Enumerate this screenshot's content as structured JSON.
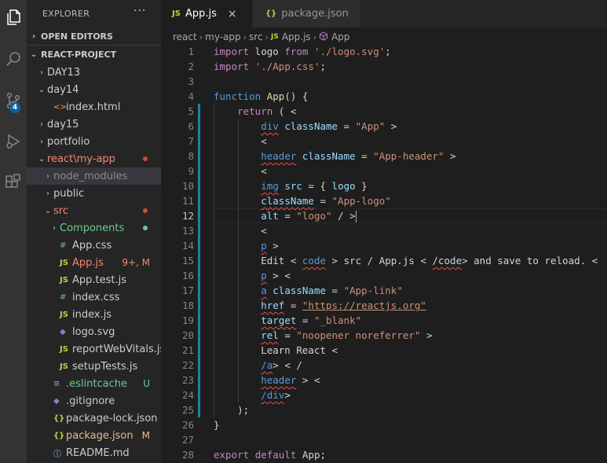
{
  "sidebar": {
    "title": "EXPLORER",
    "more": "···",
    "open_editors": "OPEN EDITORS",
    "project": "REACT-PROJECT",
    "tree": [
      {
        "label": "DAY13",
        "chev": "›",
        "icon": "",
        "deco": "",
        "color": "#cccccc"
      },
      {
        "label": "day14",
        "chev": "⌄",
        "icon": "",
        "deco": "",
        "color": "#cccccc"
      },
      {
        "label": "index.html",
        "chev": "",
        "icon": "<>",
        "deco": "",
        "color": "#cccccc"
      },
      {
        "label": "day15",
        "chev": "›",
        "icon": "",
        "deco": "",
        "color": "#cccccc"
      },
      {
        "label": "portfolio",
        "chev": "›",
        "icon": "",
        "deco": "",
        "color": "#cccccc"
      },
      {
        "label": "react\\my-app",
        "chev": "⌄",
        "icon": "",
        "deco": "",
        "color": "#f48771"
      },
      {
        "label": "node_modules",
        "chev": "›",
        "icon": "",
        "deco": "",
        "color": "#8c8c8c"
      },
      {
        "label": "public",
        "chev": "›",
        "icon": "",
        "deco": "",
        "color": "#cccccc"
      },
      {
        "label": "src",
        "chev": "⌄",
        "icon": "",
        "deco": "",
        "color": "#f48771"
      },
      {
        "label": "Components",
        "chev": "›",
        "icon": "",
        "deco": "",
        "color": "#73c991"
      },
      {
        "label": "App.css",
        "chev": "",
        "icon": "#",
        "deco": "",
        "color": "#cccccc"
      },
      {
        "label": "App.js",
        "chev": "",
        "icon": "JS",
        "deco": "9+, M",
        "color": "#f48771"
      },
      {
        "label": "App.test.js",
        "chev": "",
        "icon": "JS",
        "deco": "",
        "color": "#cccccc"
      },
      {
        "label": "index.css",
        "chev": "",
        "icon": "#",
        "deco": "",
        "color": "#cccccc"
      },
      {
        "label": "index.js",
        "chev": "",
        "icon": "JS",
        "deco": "",
        "color": "#cccccc"
      },
      {
        "label": "logo.svg",
        "chev": "",
        "icon": "◆",
        "deco": "",
        "color": "#cccccc"
      },
      {
        "label": "reportWebVitals.js",
        "chev": "",
        "icon": "JS",
        "deco": "",
        "color": "#cccccc"
      },
      {
        "label": "setupTests.js",
        "chev": "",
        "icon": "JS",
        "deco": "",
        "color": "#cccccc"
      },
      {
        "label": ".eslintcache",
        "chev": "",
        "icon": "≡",
        "deco": "U",
        "color": "#73c991"
      },
      {
        "label": ".gitignore",
        "chev": "",
        "icon": "◆",
        "deco": "",
        "color": "#cccccc"
      },
      {
        "label": "package-lock.json",
        "chev": "",
        "icon": "{}",
        "deco": "",
        "color": "#cccccc"
      },
      {
        "label": "package.json",
        "chev": "",
        "icon": "{}",
        "deco": "M",
        "color": "#e2c08d"
      },
      {
        "label": "README.md",
        "chev": "",
        "icon": "ⓘ",
        "deco": "",
        "color": "#cccccc"
      }
    ]
  },
  "activity": {
    "scm_badge": "4"
  },
  "tabs": [
    {
      "label": "App.js",
      "icon": "JS",
      "close": "×"
    },
    {
      "label": "package.json",
      "icon": "{}"
    }
  ],
  "breadcrumb": [
    "react",
    "my-app",
    "src",
    "App.js",
    "App"
  ],
  "editor": {
    "current_line": 12,
    "lines": [
      "import logo from './logo.svg';",
      "import './App.css';",
      "",
      "function App() {",
      "    return ( <",
      "        div className = \"App\" >",
      "        <",
      "        header className = \"App-header\" >",
      "        <",
      "        img src = { logo }",
      "        className = \"App-logo\"",
      "        alt = \"logo\" / >",
      "        <",
      "        p >",
      "        Edit < code > src / App.js < /code> and save to reload. <",
      "        p > <",
      "        a className = \"App-link\"",
      "        href = \"https://reactjs.org\"",
      "        target = \"_blank\"",
      "        rel = \"noopener noreferrer\" >",
      "        Learn React <",
      "        /a> < /",
      "        header > <",
      "        /div>",
      "    );",
      "}",
      "",
      "export default App;"
    ]
  }
}
